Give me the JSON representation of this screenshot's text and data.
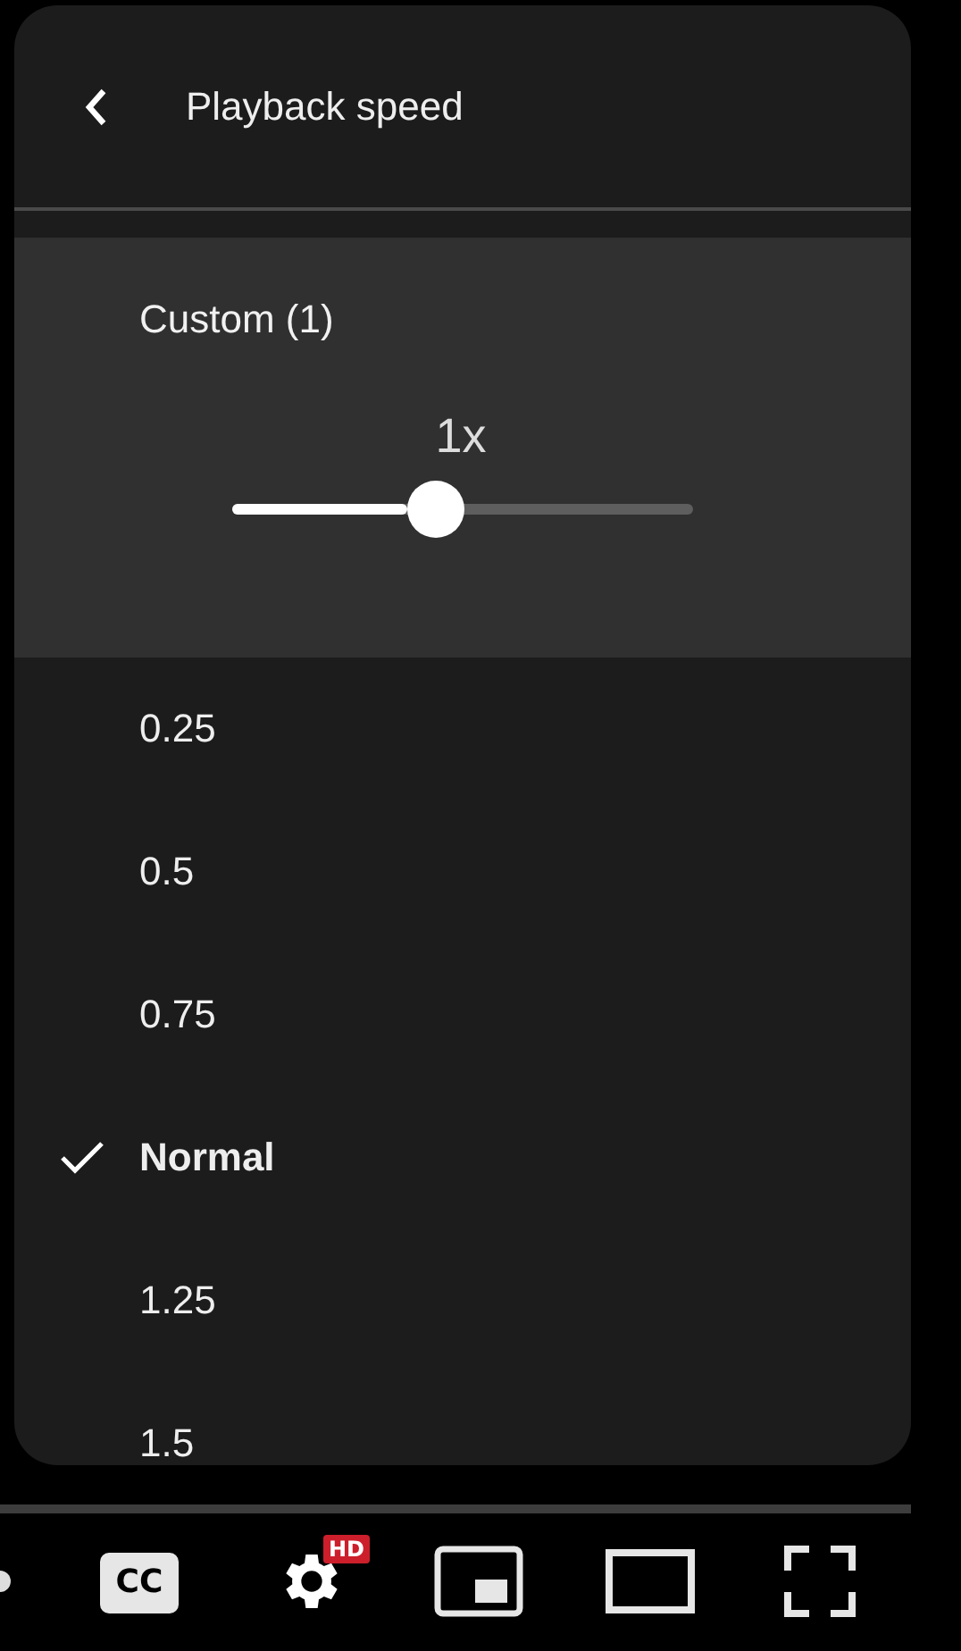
{
  "menu": {
    "title": "Playback speed",
    "custom": {
      "label": "Custom (1)",
      "value": "1x",
      "level": 0.44
    },
    "options": [
      {
        "label": "0.25",
        "selected": false
      },
      {
        "label": "0.5",
        "selected": false
      },
      {
        "label": "0.75",
        "selected": false
      },
      {
        "label": "Normal",
        "selected": true
      },
      {
        "label": "1.25",
        "selected": false
      },
      {
        "label": "1.5",
        "selected": false
      }
    ]
  },
  "controls": {
    "captions": "CC",
    "hd_badge": "HD"
  }
}
